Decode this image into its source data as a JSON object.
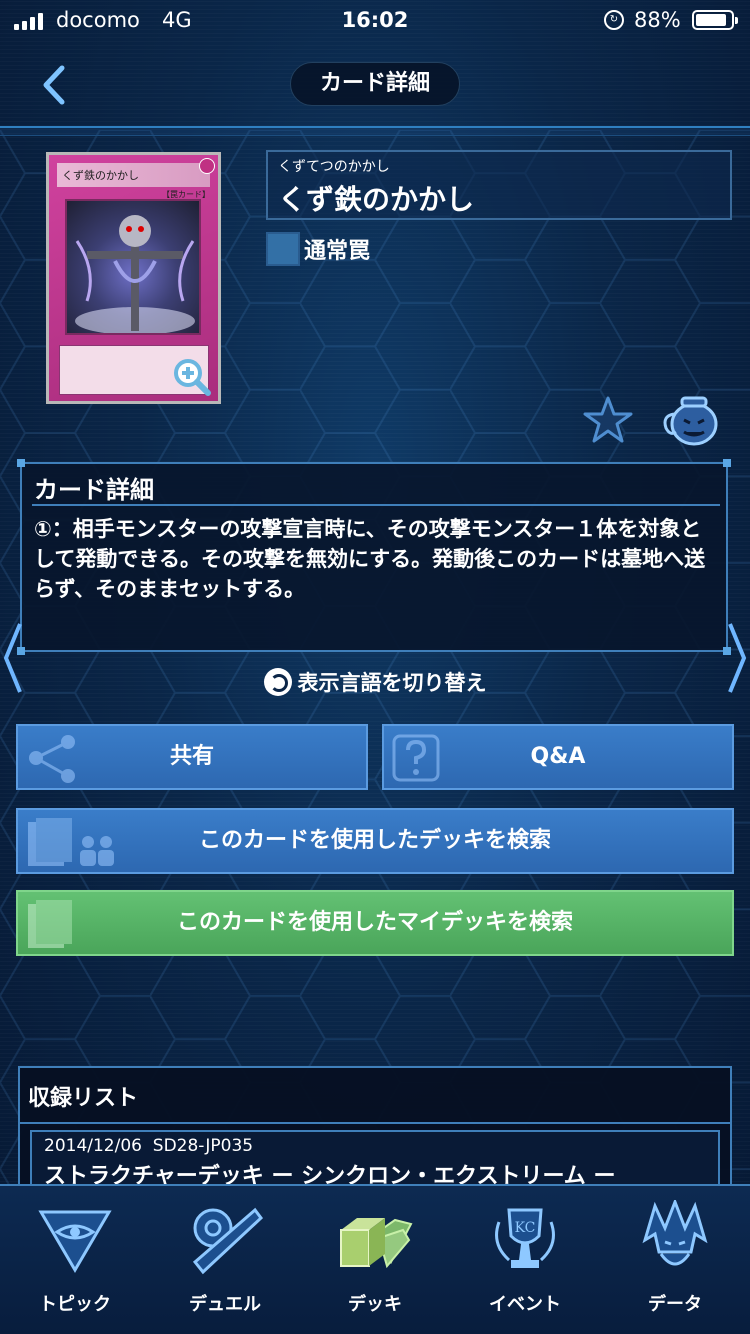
{
  "status_bar": {
    "carrier": "docomo",
    "network": "4G",
    "time": "16:02",
    "battery_percent": "88%",
    "battery_level": 0.88
  },
  "header": {
    "title": "カード詳細"
  },
  "card": {
    "image_name_text": "くず鉄のかかし",
    "image_type_tag": "【罠カード】",
    "ruby": "くずてつのかかし",
    "name": "くず鉄のかかし",
    "type": "通常罠",
    "type_color": "#3370a6"
  },
  "detail": {
    "heading": "カード詳細",
    "text": "①：相手モンスターの攻撃宣言時に、その攻撃モンスター１体を対象として発動できる。その攻撃を無効にする。発動後このカードは墓地へ送らず、そのままセットする。"
  },
  "language_toggle": {
    "label": "表示言語を切り替え"
  },
  "buttons": {
    "share": "共有",
    "qa": "Q&A",
    "search_decks": "このカードを使用したデッキを検索",
    "search_my_decks": "このカードを使用したマイデッキを検索"
  },
  "colors": {
    "button_blue": "#2d68b1",
    "button_green": "#4aa55a",
    "frame": "#3f7fba"
  },
  "product_list": {
    "heading": "収録リスト",
    "items": [
      {
        "date": "2014/12/06",
        "code": "SD28-JP035",
        "title": "ストラクチャーデッキ ー シンクロン・エクストリーム ー"
      }
    ]
  },
  "tabbar": {
    "items": [
      {
        "label": "トピック",
        "icon": "millennium-eye-icon"
      },
      {
        "label": "デュエル",
        "icon": "duel-disk-icon"
      },
      {
        "label": "デッキ",
        "icon": "deck-icon"
      },
      {
        "label": "イベント",
        "icon": "trophy-icon"
      },
      {
        "label": "データ",
        "icon": "character-icon"
      }
    ]
  }
}
